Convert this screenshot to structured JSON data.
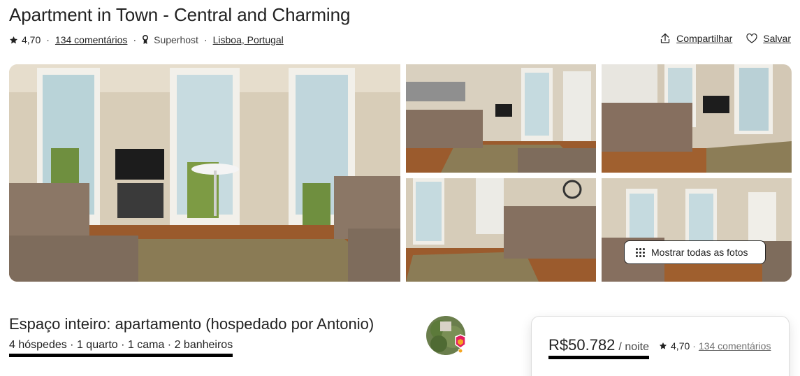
{
  "listing": {
    "title": "Apartment in Town - Central and Charming",
    "rating": "4,70",
    "reviews_link": "134 comentários",
    "superhost": "Superhost",
    "location": "Lisboa, Portugal",
    "separator": "·"
  },
  "actions": {
    "share": "Compartilhar",
    "save": "Salvar"
  },
  "gallery": {
    "show_all": "Mostrar todas as fotos"
  },
  "overview": {
    "title": "Espaço inteiro: apartamento (hospedado por Antonio)",
    "details": "4 hóspedes · 1 quarto · 1 cama · 2 banheiros"
  },
  "booking": {
    "price": "R$50.782",
    "per_night": "/ noite",
    "rating": "4,70",
    "separator": "·",
    "reviews_link": "134 comentários"
  },
  "icons": {
    "star": "star-icon",
    "superhost": "superhost-medal-icon",
    "share": "share-icon",
    "save": "heart-icon",
    "show_all": "grid-dots-icon"
  },
  "colors": {
    "text": "#222222",
    "muted": "#717171",
    "brand": "#FF385C",
    "border": "#dddddd"
  }
}
